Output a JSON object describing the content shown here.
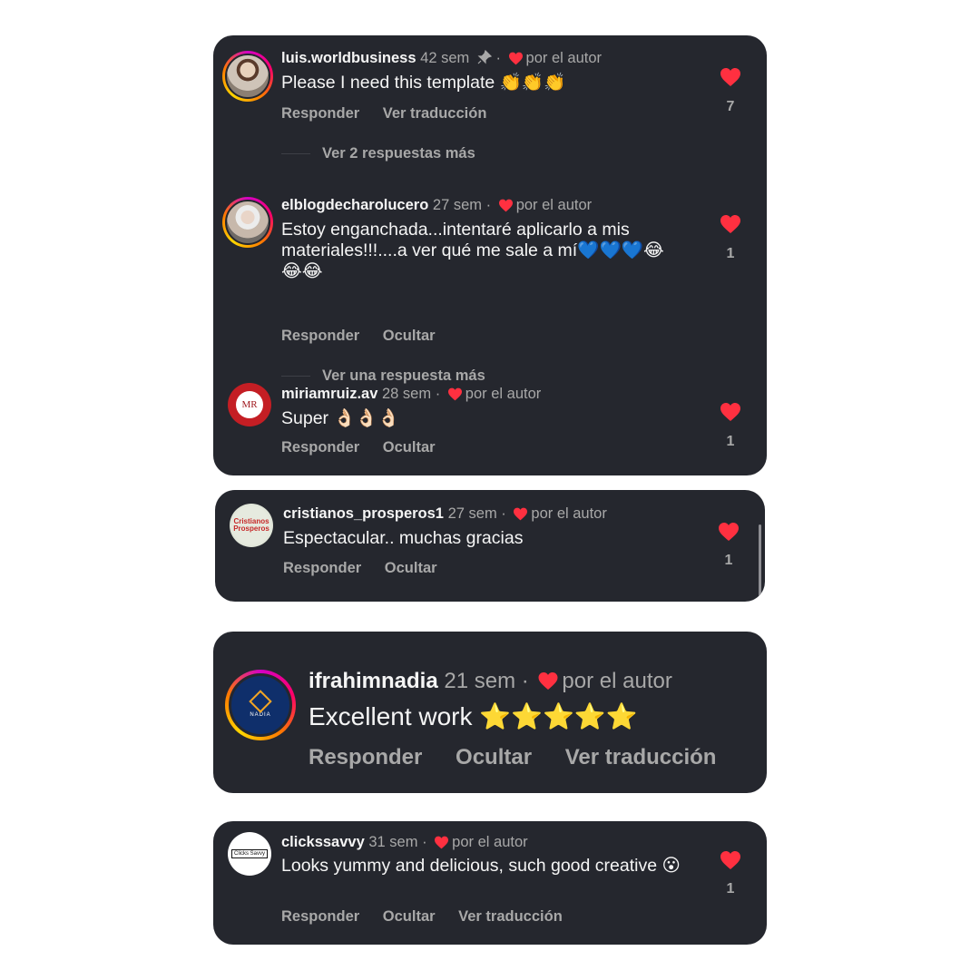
{
  "colors": {
    "heart": "#ff3040",
    "card": "#25272e",
    "muted": "#a8a8a8"
  },
  "heart_icon": "heart-icon",
  "comments": [
    {
      "username": "luis.worldbusiness",
      "time": "42 sem",
      "pinned": true,
      "separator": "·",
      "author_label": "por el autor",
      "text": "Please I need this template 👏👏👏",
      "actions": [
        "Responder",
        "Ver traducción"
      ],
      "likes": "7",
      "more_replies": "Ver 2 respuestas más"
    },
    {
      "username": "elblogdecharolucero",
      "time": "27 sem",
      "separator": "·",
      "author_label": "por el autor",
      "text": "Estoy enganchada...intentaré aplicarlo a mis materiales!!!....a ver qué  me sale a mí💙💙💙😂😂😂",
      "actions": [
        "Responder",
        "Ocultar"
      ],
      "likes": "1",
      "more_replies": "Ver una respuesta más"
    },
    {
      "username": "miriamruiz.av",
      "time": "28 sem",
      "separator": "·",
      "author_label": "por el autor",
      "text": "Super 👌🏻👌🏻👌🏻",
      "actions": [
        "Responder",
        "Ocultar"
      ],
      "likes": "1",
      "avatar_text": "MR"
    },
    {
      "username": "cristianos_prosperos1",
      "time": "27 sem",
      "separator": "·",
      "author_label": "por el autor",
      "text": "Espectacular.. muchas gracias",
      "actions": [
        "Responder",
        "Ocultar"
      ],
      "likes": "1",
      "avatar_text": "Cristianos Prosperos"
    },
    {
      "username": "ifrahimnadia",
      "time": "21 sem",
      "separator": "·",
      "author_label": "por el autor",
      "text": "Excellent work ⭐⭐⭐⭐⭐",
      "actions": [
        "Responder",
        "Ocultar",
        "Ver traducción"
      ],
      "avatar_text": "NADIA"
    },
    {
      "username": "clickssavvy",
      "time": "31 sem",
      "separator": "·",
      "author_label": "por el autor",
      "text": "Looks yummy and delicious,  such good creative 😮",
      "actions": [
        "Responder",
        "Ocultar",
        "Ver traducción"
      ],
      "likes": "1",
      "avatar_text": "Clicks Savvy"
    }
  ]
}
